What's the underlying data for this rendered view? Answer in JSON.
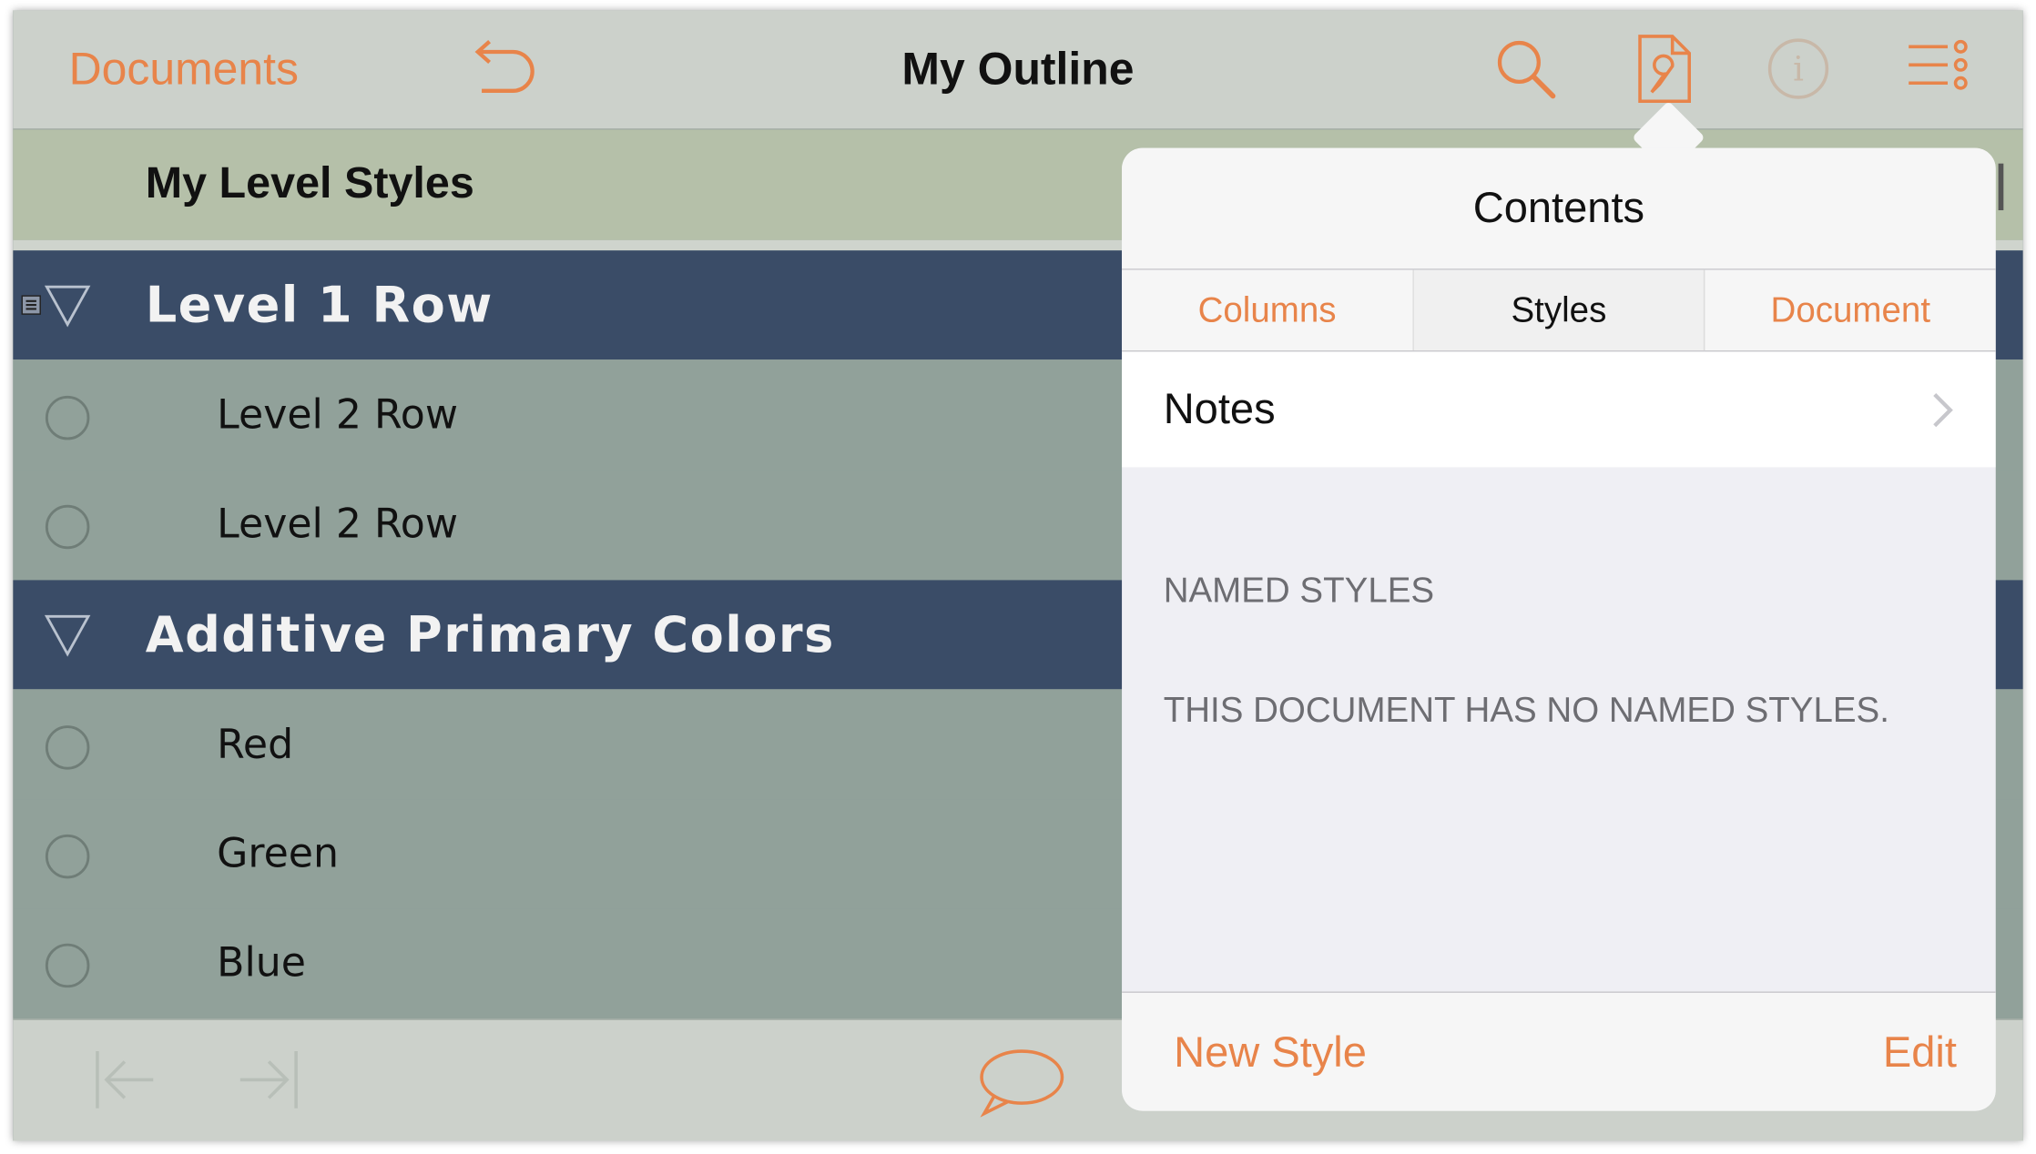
{
  "navbar": {
    "documents_label": "Documents",
    "title": "My Outline",
    "icons": [
      "undo-icon",
      "search-icon",
      "inspector-icon",
      "info-icon",
      "outline-menu-icon"
    ]
  },
  "level_header": {
    "label": "My Level Styles"
  },
  "rows": [
    {
      "level": 1,
      "label": "Level 1 Row"
    },
    {
      "level": 2,
      "label": "Level 2 Row"
    },
    {
      "level": 2,
      "label": "Level 2 Row"
    },
    {
      "level": 1,
      "label": "Additive Primary Colors"
    },
    {
      "level": 2,
      "label": "Red"
    },
    {
      "level": 2,
      "label": "Green"
    },
    {
      "level": 2,
      "label": "Blue"
    }
  ],
  "toolbar": {
    "icons": [
      "outdent-icon",
      "indent-icon",
      "note-bubble-icon"
    ]
  },
  "popover": {
    "title": "Contents",
    "tabs": [
      {
        "label": "Columns",
        "active": false
      },
      {
        "label": "Styles",
        "active": true
      },
      {
        "label": "Document",
        "active": false
      }
    ],
    "notes_label": "Notes",
    "section_header": "NAMED STYLES",
    "empty_message": "THIS DOCUMENT HAS NO NAMED STYLES.",
    "new_style_label": "New Style",
    "edit_label": "Edit"
  },
  "colors": {
    "accent": "#e8844a",
    "level1_bg": "#3a4c67",
    "level2_bg": "#91a19a",
    "header_bg": "#b5c0a9"
  }
}
